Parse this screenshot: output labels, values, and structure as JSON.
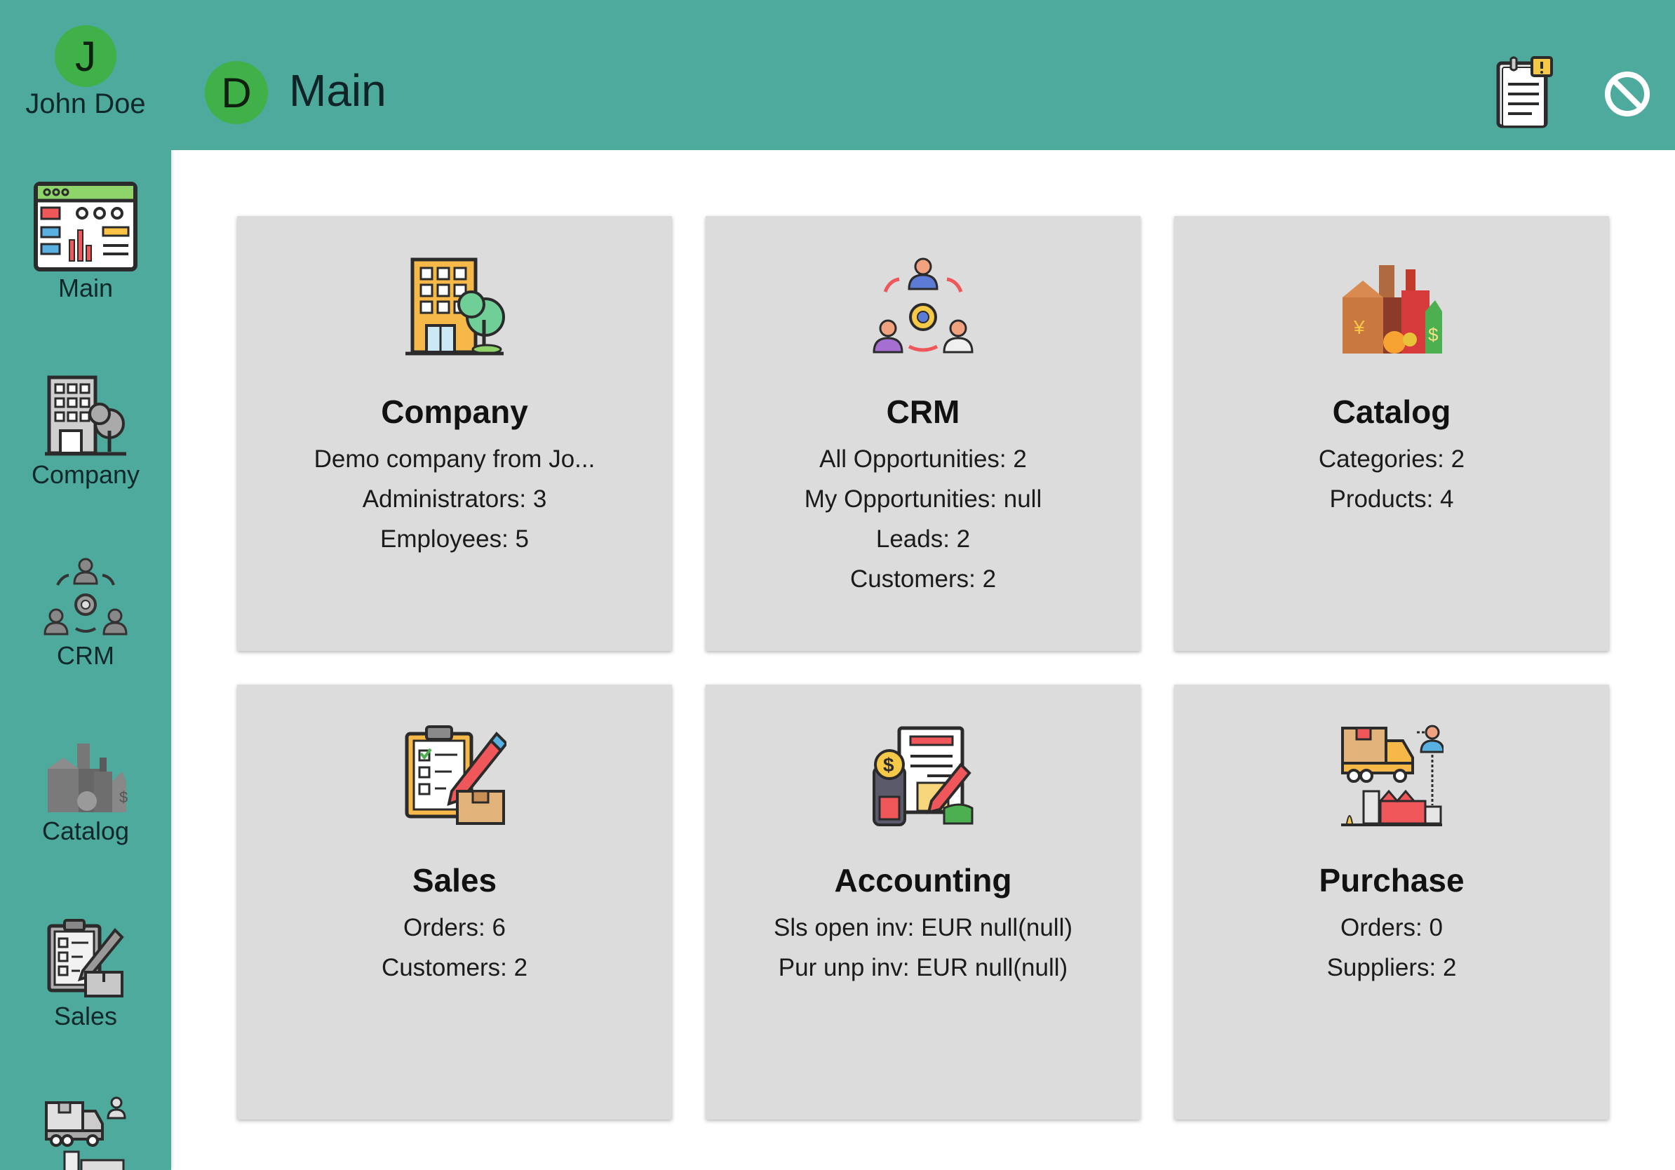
{
  "user": {
    "initial": "J",
    "name": "John Doe"
  },
  "sidebar": {
    "items": [
      {
        "label": "Main",
        "icon": "dashboard-icon"
      },
      {
        "label": "Company",
        "icon": "company-building-icon"
      },
      {
        "label": "CRM",
        "icon": "crm-people-icon"
      },
      {
        "label": "Catalog",
        "icon": "catalog-products-icon"
      },
      {
        "label": "Sales",
        "icon": "sales-clipboard-icon"
      },
      {
        "label": "",
        "icon": "purchase-truck-icon"
      }
    ]
  },
  "header": {
    "initial": "D",
    "title": "Main",
    "icons": [
      "notes-icon",
      "logout-icon"
    ]
  },
  "cards": [
    {
      "title": "Company",
      "lines": [
        "Demo company from Jo...",
        "Administrators: 3",
        "Employees: 5"
      ]
    },
    {
      "title": "CRM",
      "lines": [
        "All Opportunities: 2",
        "My Opportunities: null",
        "Leads: 2",
        "Customers: 2"
      ]
    },
    {
      "title": "Catalog",
      "lines": [
        "Categories: 2",
        "Products: 4"
      ]
    },
    {
      "title": "Sales",
      "lines": [
        "Orders: 6",
        "Customers: 2"
      ]
    },
    {
      "title": "Accounting",
      "lines": [
        "Sls open inv: EUR null(null)",
        "Pur unp inv: EUR null(null)"
      ]
    },
    {
      "title": "Purchase",
      "lines": [
        "Orders: 0",
        "Suppliers: 2"
      ]
    }
  ],
  "colors": {
    "primary": "#4daa9d",
    "avatar": "#40b049",
    "card": "#dcdcdc"
  }
}
